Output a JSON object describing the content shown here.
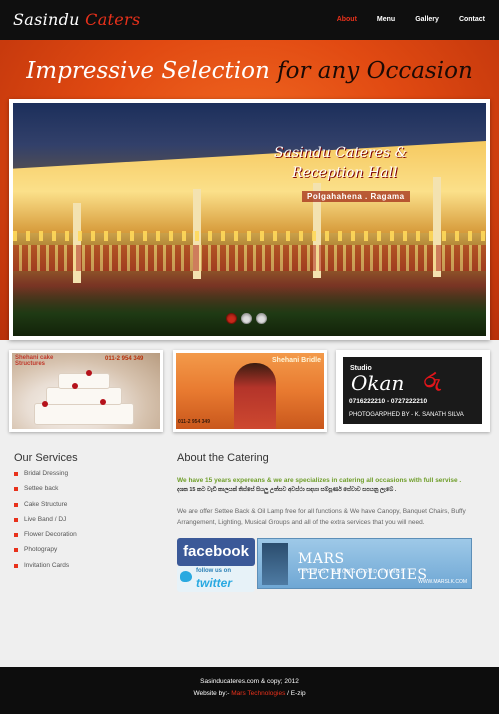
{
  "header": {
    "logo_main": "Sasindu ",
    "logo_accent": "Caters",
    "nav": [
      "About",
      "Menu",
      "Gallery",
      "Contact"
    ],
    "active_nav": "About"
  },
  "banner": {
    "tagline_light": "Impressive Selection ",
    "tagline_dark": "for any Occasion",
    "slide_caption_line1": "Sasindu Cateres &",
    "slide_caption_line2": "Reception Hall",
    "slide_caption_location": "Polgahahena . Ragama",
    "slide_count": 3,
    "active_slide": 1
  },
  "thumbnails": {
    "cake_label": "Shehani cake Structures",
    "cake_phone": "011-2 954 349",
    "bride_label": "Shehani Bridle",
    "bride_phone": "011-2 954 349",
    "okan_studio": "Studio",
    "okan_name": "Okan",
    "okan_sinhala": "රු",
    "okan_phones": "0716222210 - 0727222210",
    "okan_credit": "PHOTOGARPHED BY - K. SANATH SILVA"
  },
  "services": {
    "heading": "Our Services",
    "items": [
      "Bridal Dressing",
      "Settee back",
      "Cake Structure",
      "Live Band / DJ",
      "Flower Decoration",
      "Photograpy",
      "Invitation Cards"
    ]
  },
  "about": {
    "heading": "About the Catering",
    "highlight": "We have 15 years expereans & we are specializes in catering all occasions with full servise .",
    "sinhala": "දශක 15 කට වැඩි කාලයක් තිස්සේ සියලු උත්සව අවස්ථා සඳහා සම්පූර්ණ සේවාව සපයනු ලැබේ .",
    "body": "We are offer Settee Back & Oil Lamp free for all functions & We have Canopy, Banquet Chairs, Buffy Arrangement, Lighting, Musical Groups and all of the extra services that you will need."
  },
  "social": {
    "facebook": "facebook",
    "twitter_follow": "follow us on",
    "twitter": "twitter"
  },
  "mars_ad": {
    "title": "MARS TECHNOLOGIES",
    "subtitle": "THE BEST AMONG GOOD THINGS",
    "url": "WWW.MARSLK.COM"
  },
  "footer": {
    "copyright": "Sasinducateres.com & copy; 2012",
    "website_by": "Website by:- ",
    "website_link": "Mars Technologies",
    "website_suffix": " / E-zip"
  },
  "colors": {
    "accent": "#e8311b",
    "banner_orange": "#e14a12",
    "green_text": "#6f9e2a",
    "facebook_blue": "#3b5998"
  }
}
